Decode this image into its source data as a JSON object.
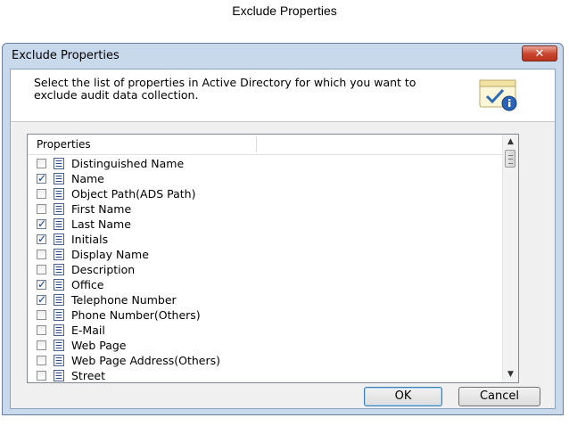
{
  "caption": "Exclude Properties",
  "window": {
    "title": "Exclude Properties",
    "close_glyph": "✕",
    "description": "Select the list of properties in Active Directory for which you want to exclude audit data collection.",
    "header_icon": "checklist-info-icon"
  },
  "list": {
    "column_header": "Properties",
    "items": [
      {
        "label": "Distinguished Name",
        "checked": false
      },
      {
        "label": "Name",
        "checked": true
      },
      {
        "label": "Object Path(ADS Path)",
        "checked": false
      },
      {
        "label": "First Name",
        "checked": false
      },
      {
        "label": "Last Name",
        "checked": true
      },
      {
        "label": "Initials",
        "checked": true
      },
      {
        "label": "Display Name",
        "checked": false
      },
      {
        "label": "Description",
        "checked": false
      },
      {
        "label": "Office",
        "checked": true
      },
      {
        "label": "Telephone Number",
        "checked": true
      },
      {
        "label": "Phone Number(Others)",
        "checked": false
      },
      {
        "label": "E-Mail",
        "checked": false
      },
      {
        "label": "Web Page",
        "checked": false
      },
      {
        "label": "Web Page Address(Others)",
        "checked": false
      },
      {
        "label": "Street",
        "checked": false
      },
      {
        "label": "",
        "checked": false
      }
    ]
  },
  "buttons": {
    "ok": "OK",
    "cancel": "Cancel"
  },
  "colors": {
    "check": "#1c3f8a",
    "frame": "#c9d9ec",
    "close": "#c8432c"
  }
}
